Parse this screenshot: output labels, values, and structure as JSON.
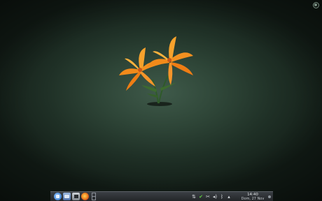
{
  "desktop": {
    "wallpaper": "Orange lilies on dark green background",
    "background_color": "#2e4537",
    "accent_flower_color": "#f7931e"
  },
  "toolbox": {
    "icon": "plasma-cashew-icon"
  },
  "panel": {
    "launchers": [
      {
        "name": "kickoff-menu",
        "icon": "kde-logo-icon"
      },
      {
        "name": "dolphin",
        "icon": "file-manager-icon"
      },
      {
        "name": "konsole",
        "icon": "terminal-icon"
      },
      {
        "name": "firefox",
        "icon": "firefox-icon"
      }
    ],
    "pager": {
      "icon": "pager-icon"
    },
    "systray": {
      "items": [
        {
          "name": "klipper",
          "icon": "clipboard-icon",
          "glyph": "⇅"
        },
        {
          "name": "update-notifier",
          "icon": "checkmark-icon",
          "glyph": "✔"
        },
        {
          "name": "network",
          "icon": "network-icon",
          "glyph": "✂"
        },
        {
          "name": "volume",
          "icon": "volume-icon",
          "glyph": "◂)"
        },
        {
          "name": "bluetooth",
          "icon": "bluetooth-icon",
          "glyph": "ᛒ"
        },
        {
          "name": "expand-tray",
          "icon": "chevron-up-icon",
          "glyph": "▴"
        }
      ]
    },
    "clock": {
      "time": "14:40",
      "date": "Dom, 27 Nov"
    }
  }
}
